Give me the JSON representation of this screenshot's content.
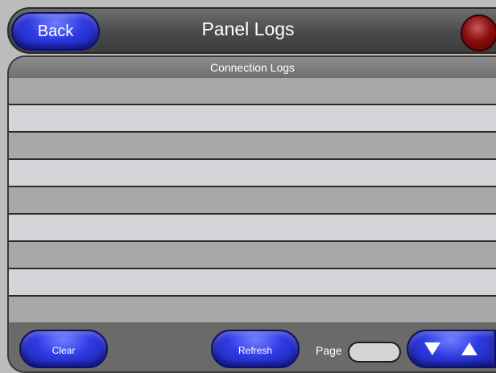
{
  "header": {
    "title": "Panel Logs",
    "back_label": "Back",
    "status_indicator_color": "#8b1010"
  },
  "log_panel": {
    "title": "Connection Logs",
    "rows": [
      "",
      "",
      "",
      "",
      "",
      "",
      "",
      "",
      ""
    ]
  },
  "footer": {
    "clear_label": "Clear",
    "refresh_label": "Refresh",
    "page_label": "Page",
    "page_value": "",
    "nav_icons": [
      "arrow-down-icon",
      "arrow-up-icon"
    ]
  },
  "colors": {
    "button_blue": "#2f3be3",
    "row_dark": "#a8a8a8",
    "row_light": "#d6d4d8",
    "chrome_gray": "#6a6a6a"
  }
}
